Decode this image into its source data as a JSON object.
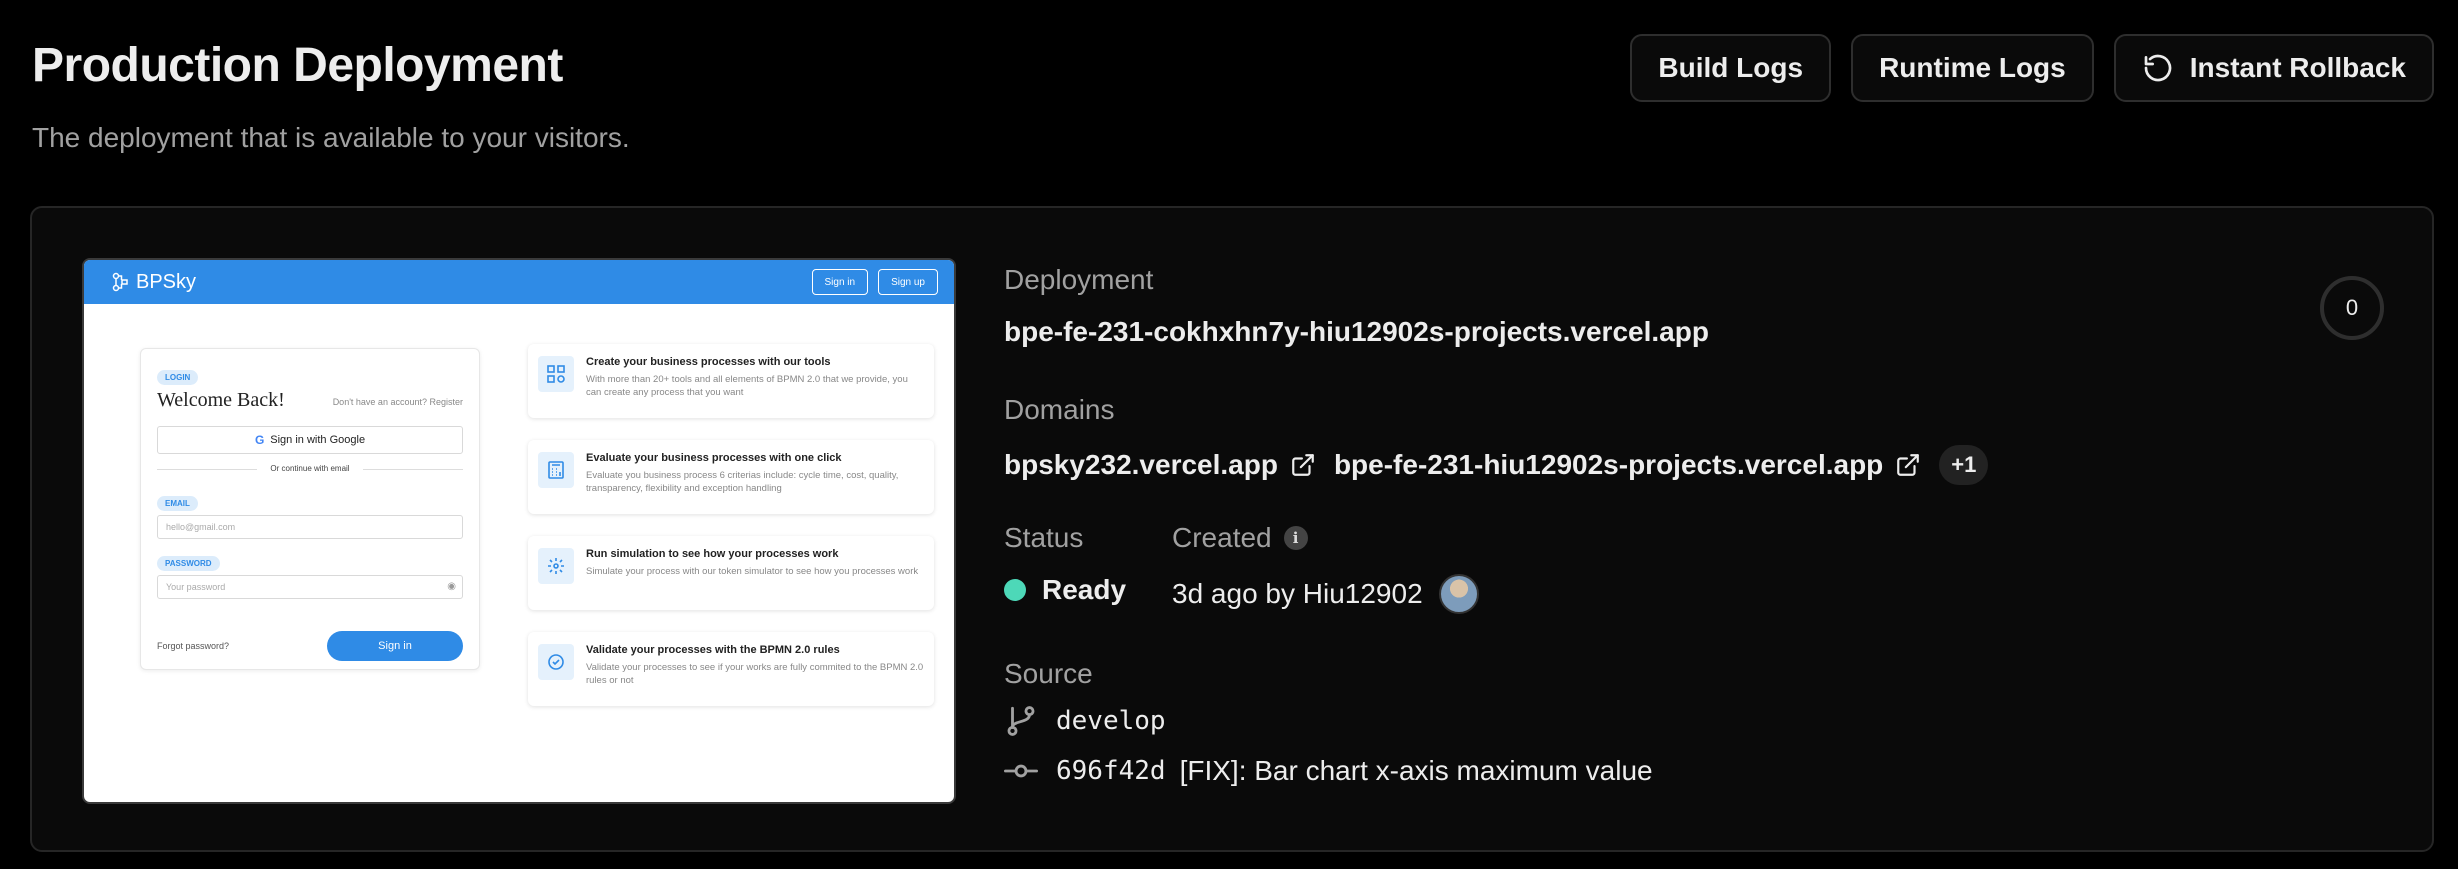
{
  "header": {
    "title": "Production Deployment",
    "subtitle": "The deployment that is available to your visitors."
  },
  "actions": {
    "build_logs": "Build Logs",
    "runtime_logs": "Runtime Logs",
    "instant_rollback": "Instant Rollback"
  },
  "preview": {
    "brand": "BPSky",
    "nav_sign_in": "Sign in",
    "nav_sign_up": "Sign up",
    "login_badge": "LOGIN",
    "welcome": "Welcome Back!",
    "register_prompt": "Don't have an account? Register",
    "google_button": "Sign in with Google",
    "or_text": "Or continue with email",
    "email_label": "EMAIL",
    "email_placeholder": "hello@gmail.com",
    "password_label": "PASSWORD",
    "password_placeholder": "Your password",
    "forgot_password": "Forgot password?",
    "sign_in_button": "Sign in",
    "features": [
      {
        "title": "Create your business processes with our tools",
        "desc": "With more than 20+ tools and all elements of BPMN 2.0 that we provide, you can create any process that you want",
        "icon": "grid-icon"
      },
      {
        "title": "Evaluate your business processes with one click",
        "desc": "Evaluate you business process 6 criterias include: cycle time, cost, quality, transparency, flexibility and exception handling",
        "icon": "calculator-icon"
      },
      {
        "title": "Run simulation to see how your processes work",
        "desc": "Simulate your process with our token simulator to see how you processes work",
        "icon": "simulation-icon"
      },
      {
        "title": "Validate your processes with the BPMN 2.0 rules",
        "desc": "Validate your processes to see if your works are fully commited to the BPMN 2.0 rules or not",
        "icon": "check-circle-icon"
      }
    ]
  },
  "deployment": {
    "label": "Deployment",
    "url": "bpe-fe-231-cokhxhn7y-hiu12902s-projects.vercel.app",
    "counter": "0"
  },
  "domains": {
    "label": "Domains",
    "items": [
      "bpsky232.vercel.app",
      "bpe-fe-231-hiu12902s-projects.vercel.app"
    ],
    "more": "+1"
  },
  "status": {
    "label": "Status",
    "value": "Ready",
    "color": "#4dd8b8"
  },
  "created": {
    "label": "Created",
    "value": "3d ago by Hiu12902"
  },
  "source": {
    "label": "Source",
    "branch": "develop",
    "commit_hash": "696f42d",
    "commit_message": "[FIX]: Bar chart x-axis maximum value"
  }
}
